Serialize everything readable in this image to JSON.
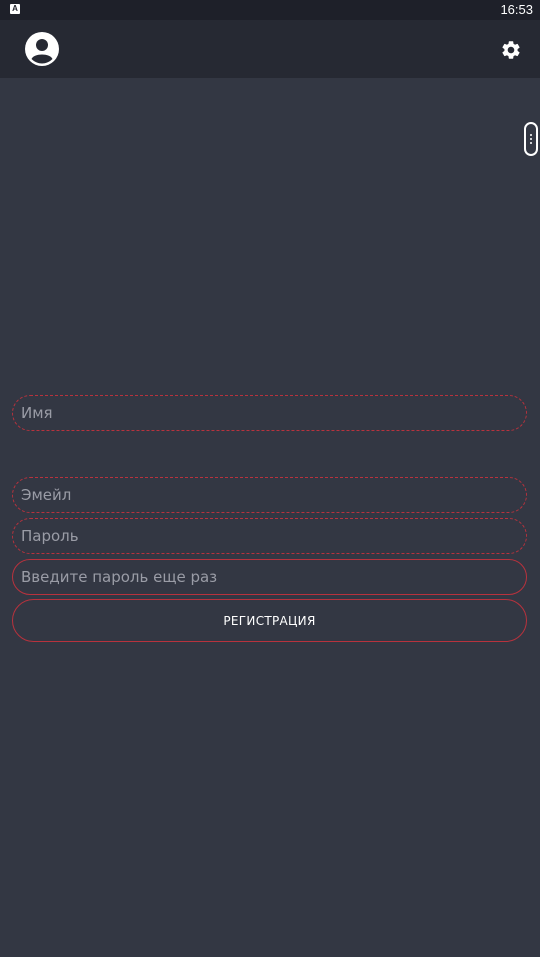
{
  "status_bar": {
    "time": "16:53",
    "notification_glyph": "A"
  },
  "app_bar": {
    "profile_icon": "account-circle-icon",
    "settings_icon": "gear-icon"
  },
  "form": {
    "name_placeholder": "Имя",
    "email_placeholder": "Эмейл",
    "password_placeholder": "Пароль",
    "password_repeat_placeholder": "Введите пароль еще раз",
    "register_label": "РЕГИСТРАЦИЯ"
  },
  "colors": {
    "background": "#333743",
    "app_bar": "#262933",
    "status_bar": "#1e2029",
    "accent_border": "#b8323d"
  }
}
